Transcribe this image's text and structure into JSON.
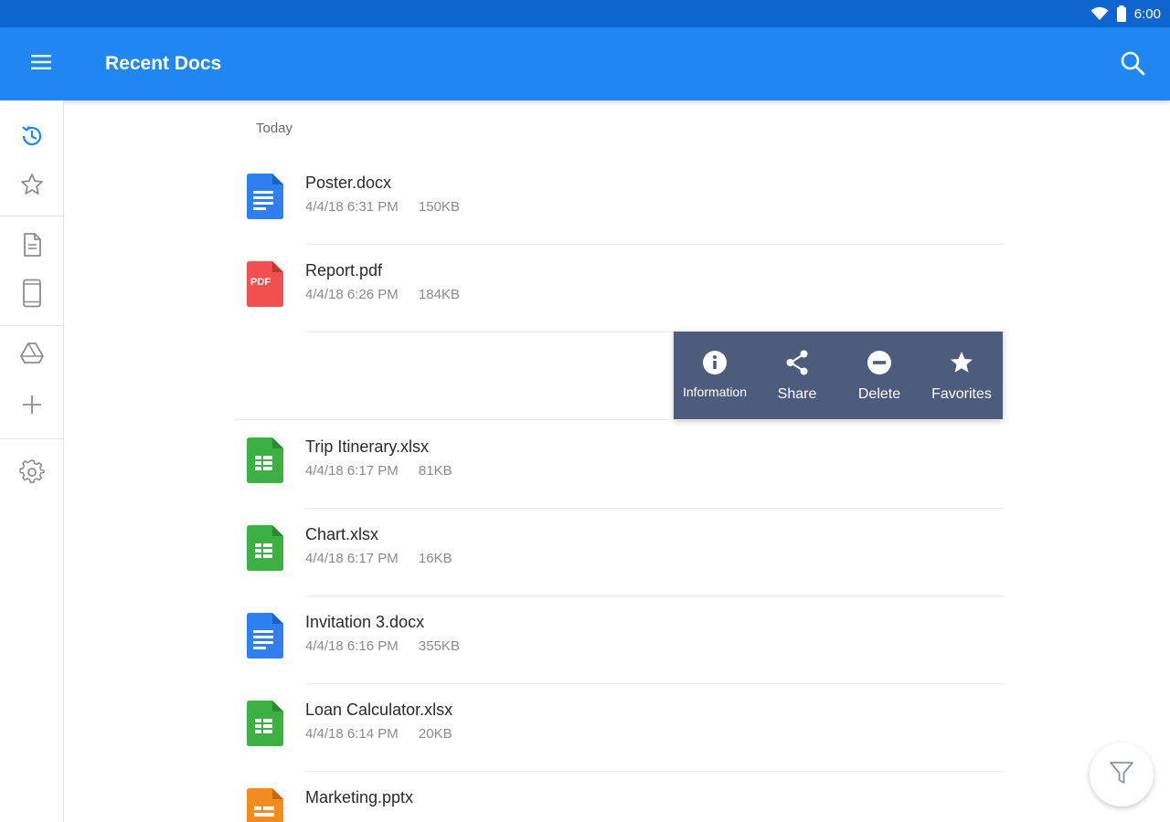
{
  "status_bar": {
    "time": "6:00",
    "icons": [
      "wifi-icon",
      "battery-icon"
    ]
  },
  "app_bar": {
    "title": "Recent Docs",
    "left_icon": "menu-icon",
    "right_icon": "search-icon"
  },
  "rail": {
    "items": [
      {
        "name": "recent",
        "icon": "recent-clock-icon",
        "active": true
      },
      {
        "name": "favorites",
        "icon": "star-outline-icon",
        "active": false
      },
      {
        "name": "documents",
        "icon": "document-icon",
        "active": false
      },
      {
        "name": "device",
        "icon": "phone-icon",
        "active": false
      },
      {
        "name": "drive",
        "icon": "drive-icon",
        "active": false
      },
      {
        "name": "add",
        "icon": "plus-icon",
        "active": false
      },
      {
        "name": "settings",
        "icon": "gear-icon",
        "active": false
      }
    ]
  },
  "list": {
    "section": "Today",
    "files": [
      {
        "name": "Poster.docx",
        "datetime": "4/4/18 6:31 PM",
        "size": "150KB",
        "type": "docx"
      },
      {
        "name": "Report.pdf",
        "datetime": "4/4/18 6:26 PM",
        "size": "184KB",
        "type": "pdf",
        "pdf_label": "PDF"
      },
      {
        "name": "Trip Itinerary.xlsx",
        "datetime": "4/4/18 6:17 PM",
        "size": "81KB",
        "type": "xlsx"
      },
      {
        "name": "Chart.xlsx",
        "datetime": "4/4/18 6:17 PM",
        "size": "16KB",
        "type": "xlsx"
      },
      {
        "name": "Invitation 3.docx",
        "datetime": "4/4/18 6:16 PM",
        "size": "355KB",
        "type": "docx"
      },
      {
        "name": "Loan Calculator.xlsx",
        "datetime": "4/4/18 6:14 PM",
        "size": "20KB",
        "type": "xlsx"
      },
      {
        "name": "Marketing.pptx",
        "datetime": "",
        "size": "",
        "type": "pptx"
      }
    ]
  },
  "context_menu": {
    "items": [
      {
        "label": "Information",
        "icon": "info-icon"
      },
      {
        "label": "Share",
        "icon": "share-icon"
      },
      {
        "label": "Delete",
        "icon": "remove-icon"
      },
      {
        "label": "Favorites",
        "icon": "star-icon"
      }
    ]
  },
  "fab": {
    "icon": "filter-icon"
  },
  "colors": {
    "status_bar": "#0f65d0",
    "app_bar": "#1f86f2",
    "accent": "#1f86f2",
    "docx": "#2f7ff0",
    "pdf": "#f25050",
    "xlsx": "#3cb043",
    "pptx": "#f28c1e",
    "context_menu": "#4d5b7c"
  }
}
